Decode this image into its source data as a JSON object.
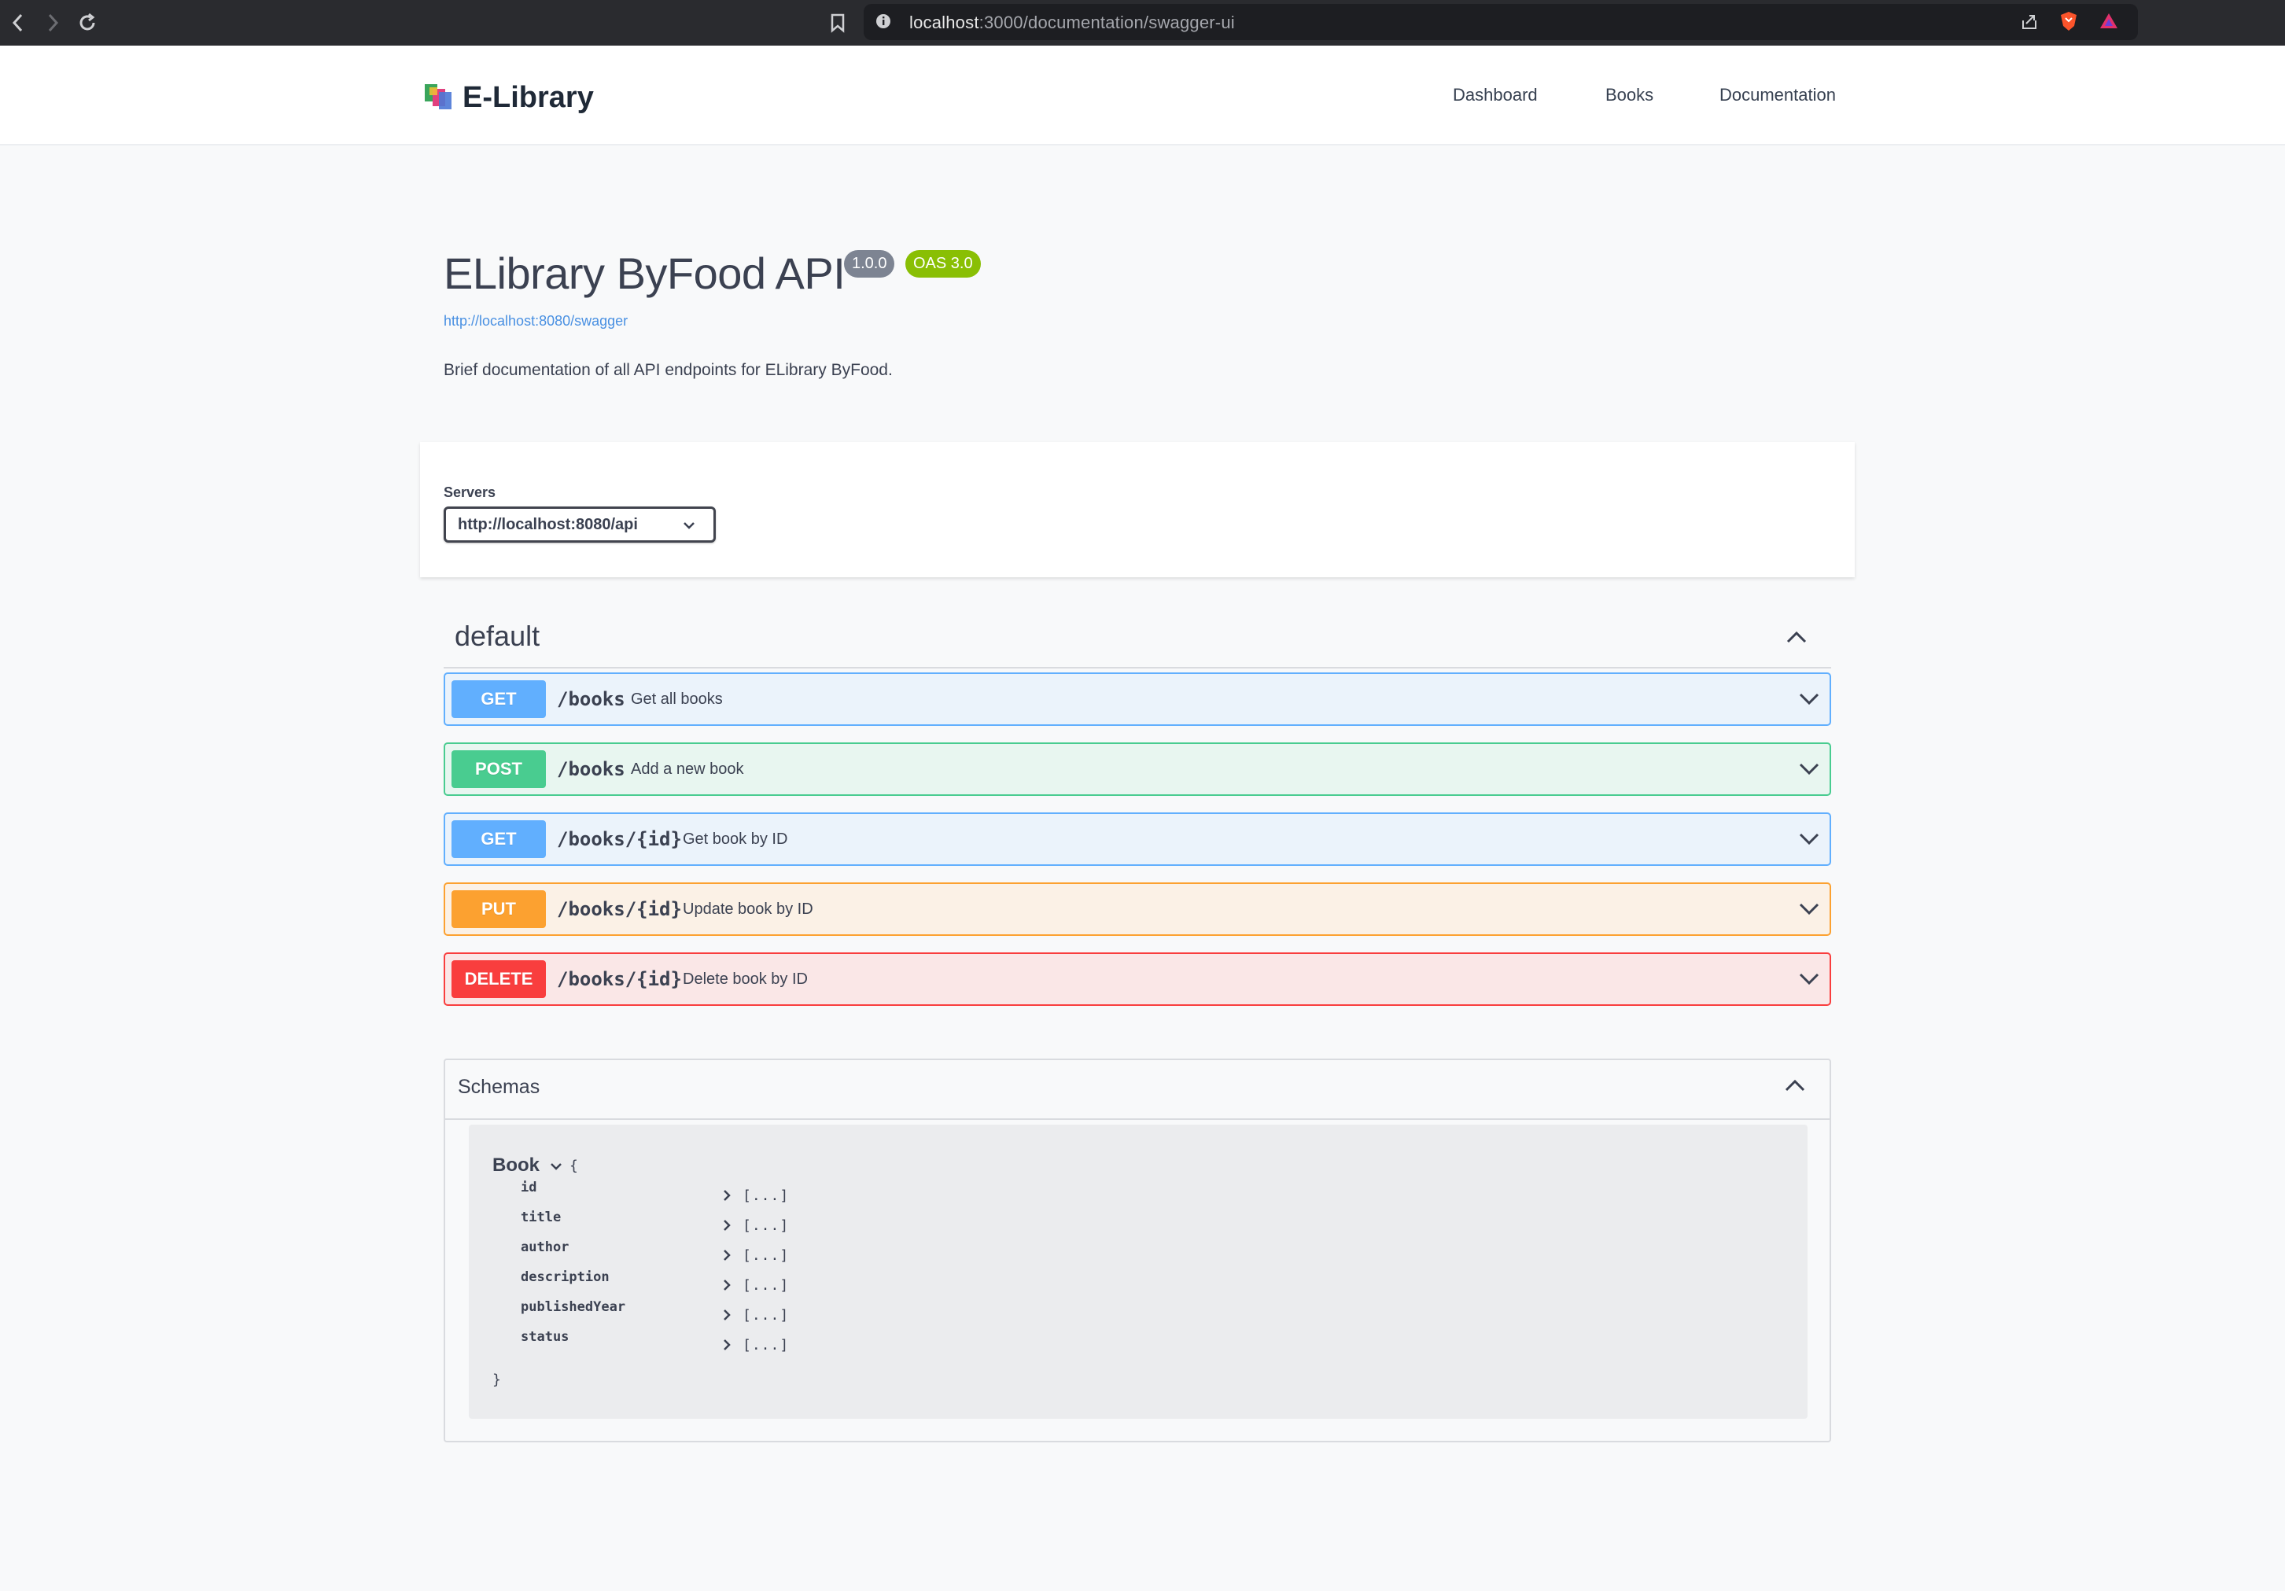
{
  "browser": {
    "url_host": "localhost",
    "url_rest": ":3000/documentation/swagger-ui"
  },
  "header": {
    "brand": "E-Library",
    "nav": [
      "Dashboard",
      "Books",
      "Documentation"
    ]
  },
  "info": {
    "title": "ELibrary ByFood API",
    "version": "1.0.0",
    "oas": "OAS 3.0",
    "spec_url": "http://localhost:8080/swagger",
    "description": "Brief documentation of all API endpoints for ELibrary ByFood."
  },
  "servers": {
    "label": "Servers",
    "selected": "http://localhost:8080/api"
  },
  "tag": {
    "name": "default"
  },
  "operations": [
    {
      "method": "GET",
      "path": "/books",
      "summary": "Get all books"
    },
    {
      "method": "POST",
      "path": "/books",
      "summary": "Add a new book"
    },
    {
      "method": "GET",
      "path": "/books/{id}",
      "summary": "Get book by ID"
    },
    {
      "method": "PUT",
      "path": "/books/{id}",
      "summary": "Update book by ID"
    },
    {
      "method": "DELETE",
      "path": "/books/{id}",
      "summary": "Delete book by ID"
    }
  ],
  "schemas": {
    "title": "Schemas",
    "model": {
      "name": "Book",
      "open_brace": "{",
      "close_brace": "}",
      "collapsed_value": "[...]",
      "properties": [
        "id",
        "title",
        "author",
        "description",
        "publishedYear",
        "status"
      ]
    }
  },
  "colors": {
    "get": "#61affe",
    "post": "#49cc90",
    "put": "#fca130",
    "delete": "#f93e3e",
    "link": "#4990e2",
    "oas_badge": "#89bf04"
  }
}
